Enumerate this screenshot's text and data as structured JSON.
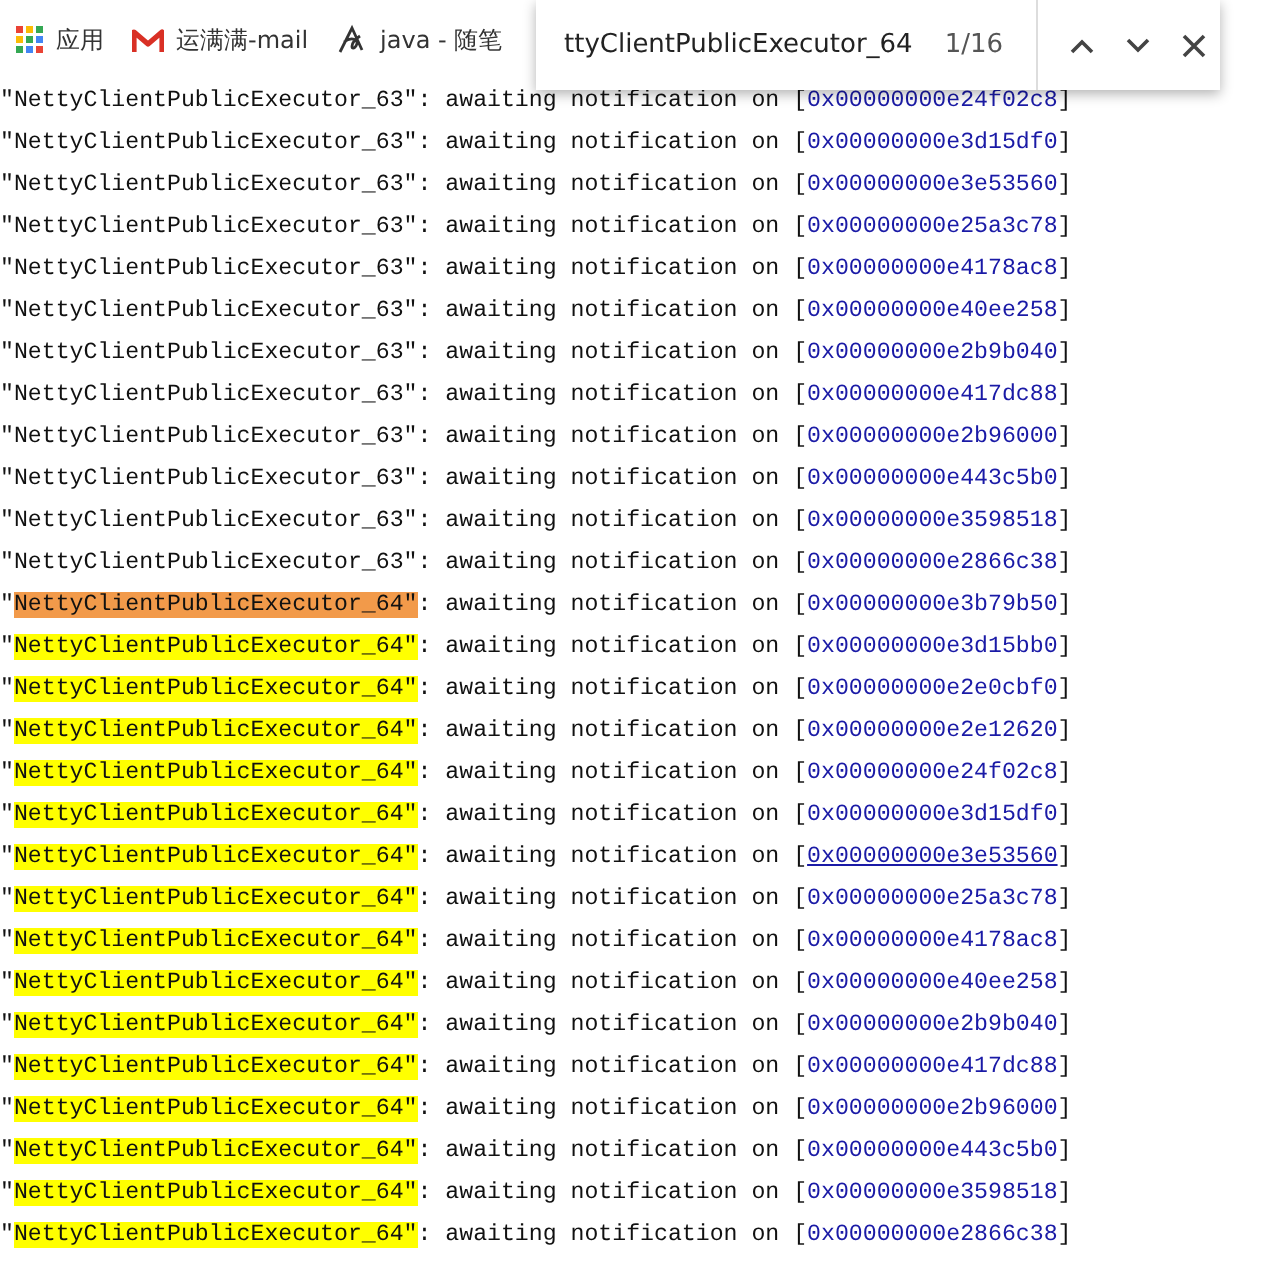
{
  "bookmarks": [
    {
      "kind": "apps",
      "label": "应用"
    },
    {
      "kind": "mail",
      "label": "运满满-mail"
    },
    {
      "kind": "blog",
      "label": "java - 随笔"
    }
  ],
  "find_bar": {
    "query": "ttyClientPublicExecutor_64",
    "count": "1/16"
  },
  "rows": [
    {
      "prefix": "\"",
      "thread": "NettyClientPublicExecutor_63\"",
      "message": ": awaiting notification on [",
      "address": "0x00000000e24f02c8",
      "suffix": "]",
      "match": false,
      "current": false,
      "hovered": false
    },
    {
      "prefix": "\"",
      "thread": "NettyClientPublicExecutor_63\"",
      "message": ": awaiting notification on [",
      "address": "0x00000000e3d15df0",
      "suffix": "]",
      "match": false,
      "current": false,
      "hovered": false
    },
    {
      "prefix": "\"",
      "thread": "NettyClientPublicExecutor_63\"",
      "message": ": awaiting notification on [",
      "address": "0x00000000e3e53560",
      "suffix": "]",
      "match": false,
      "current": false,
      "hovered": false
    },
    {
      "prefix": "\"",
      "thread": "NettyClientPublicExecutor_63\"",
      "message": ": awaiting notification on [",
      "address": "0x00000000e25a3c78",
      "suffix": "]",
      "match": false,
      "current": false,
      "hovered": false
    },
    {
      "prefix": "\"",
      "thread": "NettyClientPublicExecutor_63\"",
      "message": ": awaiting notification on [",
      "address": "0x00000000e4178ac8",
      "suffix": "]",
      "match": false,
      "current": false,
      "hovered": false
    },
    {
      "prefix": "\"",
      "thread": "NettyClientPublicExecutor_63\"",
      "message": ": awaiting notification on [",
      "address": "0x00000000e40ee258",
      "suffix": "]",
      "match": false,
      "current": false,
      "hovered": false
    },
    {
      "prefix": "\"",
      "thread": "NettyClientPublicExecutor_63\"",
      "message": ": awaiting notification on [",
      "address": "0x00000000e2b9b040",
      "suffix": "]",
      "match": false,
      "current": false,
      "hovered": false
    },
    {
      "prefix": "\"",
      "thread": "NettyClientPublicExecutor_63\"",
      "message": ": awaiting notification on [",
      "address": "0x00000000e417dc88",
      "suffix": "]",
      "match": false,
      "current": false,
      "hovered": false
    },
    {
      "prefix": "\"",
      "thread": "NettyClientPublicExecutor_63\"",
      "message": ": awaiting notification on [",
      "address": "0x00000000e2b96000",
      "suffix": "]",
      "match": false,
      "current": false,
      "hovered": false
    },
    {
      "prefix": "\"",
      "thread": "NettyClientPublicExecutor_63\"",
      "message": ": awaiting notification on [",
      "address": "0x00000000e443c5b0",
      "suffix": "]",
      "match": false,
      "current": false,
      "hovered": false
    },
    {
      "prefix": "\"",
      "thread": "NettyClientPublicExecutor_63\"",
      "message": ": awaiting notification on [",
      "address": "0x00000000e3598518",
      "suffix": "]",
      "match": false,
      "current": false,
      "hovered": false
    },
    {
      "prefix": "\"",
      "thread": "NettyClientPublicExecutor_63\"",
      "message": ": awaiting notification on [",
      "address": "0x00000000e2866c38",
      "suffix": "]",
      "match": false,
      "current": false,
      "hovered": false
    },
    {
      "prefix": "\"",
      "thread": "NettyClientPublicExecutor_64\"",
      "message": ": awaiting notification on [",
      "address": "0x00000000e3b79b50",
      "suffix": "]",
      "match": true,
      "current": true,
      "hovered": false
    },
    {
      "prefix": "\"",
      "thread": "NettyClientPublicExecutor_64\"",
      "message": ": awaiting notification on [",
      "address": "0x00000000e3d15bb0",
      "suffix": "]",
      "match": true,
      "current": false,
      "hovered": false
    },
    {
      "prefix": "\"",
      "thread": "NettyClientPublicExecutor_64\"",
      "message": ": awaiting notification on [",
      "address": "0x00000000e2e0cbf0",
      "suffix": "]",
      "match": true,
      "current": false,
      "hovered": false
    },
    {
      "prefix": "\"",
      "thread": "NettyClientPublicExecutor_64\"",
      "message": ": awaiting notification on [",
      "address": "0x00000000e2e12620",
      "suffix": "]",
      "match": true,
      "current": false,
      "hovered": false
    },
    {
      "prefix": "\"",
      "thread": "NettyClientPublicExecutor_64\"",
      "message": ": awaiting notification on [",
      "address": "0x00000000e24f02c8",
      "suffix": "]",
      "match": true,
      "current": false,
      "hovered": false
    },
    {
      "prefix": "\"",
      "thread": "NettyClientPublicExecutor_64\"",
      "message": ": awaiting notification on [",
      "address": "0x00000000e3d15df0",
      "suffix": "]",
      "match": true,
      "current": false,
      "hovered": false
    },
    {
      "prefix": "\"",
      "thread": "NettyClientPublicExecutor_64\"",
      "message": ": awaiting notification on [",
      "address": "0x00000000e3e53560",
      "suffix": "]",
      "match": true,
      "current": false,
      "hovered": true
    },
    {
      "prefix": "\"",
      "thread": "NettyClientPublicExecutor_64\"",
      "message": ": awaiting notification on [",
      "address": "0x00000000e25a3c78",
      "suffix": "]",
      "match": true,
      "current": false,
      "hovered": false
    },
    {
      "prefix": "\"",
      "thread": "NettyClientPublicExecutor_64\"",
      "message": ": awaiting notification on [",
      "address": "0x00000000e4178ac8",
      "suffix": "]",
      "match": true,
      "current": false,
      "hovered": false
    },
    {
      "prefix": "\"",
      "thread": "NettyClientPublicExecutor_64\"",
      "message": ": awaiting notification on [",
      "address": "0x00000000e40ee258",
      "suffix": "]",
      "match": true,
      "current": false,
      "hovered": false
    },
    {
      "prefix": "\"",
      "thread": "NettyClientPublicExecutor_64\"",
      "message": ": awaiting notification on [",
      "address": "0x00000000e2b9b040",
      "suffix": "]",
      "match": true,
      "current": false,
      "hovered": false
    },
    {
      "prefix": "\"",
      "thread": "NettyClientPublicExecutor_64\"",
      "message": ": awaiting notification on [",
      "address": "0x00000000e417dc88",
      "suffix": "]",
      "match": true,
      "current": false,
      "hovered": false
    },
    {
      "prefix": "\"",
      "thread": "NettyClientPublicExecutor_64\"",
      "message": ": awaiting notification on [",
      "address": "0x00000000e2b96000",
      "suffix": "]",
      "match": true,
      "current": false,
      "hovered": false
    },
    {
      "prefix": "\"",
      "thread": "NettyClientPublicExecutor_64\"",
      "message": ": awaiting notification on [",
      "address": "0x00000000e443c5b0",
      "suffix": "]",
      "match": true,
      "current": false,
      "hovered": false
    },
    {
      "prefix": "\"",
      "thread": "NettyClientPublicExecutor_64\"",
      "message": ": awaiting notification on [",
      "address": "0x00000000e3598518",
      "suffix": "]",
      "match": true,
      "current": false,
      "hovered": false
    },
    {
      "prefix": "\"",
      "thread": "NettyClientPublicExecutor_64\"",
      "message": ": awaiting notification on [",
      "address": "0x00000000e2866c38",
      "suffix": "]",
      "match": true,
      "current": false,
      "hovered": false
    }
  ]
}
